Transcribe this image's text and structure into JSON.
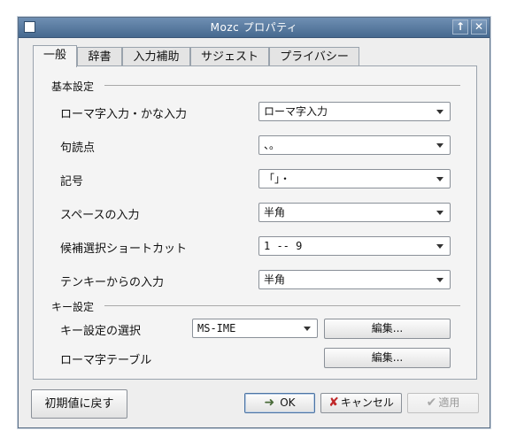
{
  "window": {
    "title": "Mozc プロパティ"
  },
  "titlebar": {
    "up_label": "↑",
    "close_label": "✕"
  },
  "tabs": [
    "一般",
    "辞書",
    "入力補助",
    "サジェスト",
    "プライバシー"
  ],
  "basic": {
    "group_title": "基本設定",
    "rows": [
      {
        "label": "ローマ字入力・かな入力",
        "value": "ローマ字入力"
      },
      {
        "label": "句読点",
        "value": "、。"
      },
      {
        "label": "記号",
        "value": "「」・"
      },
      {
        "label": "スペースの入力",
        "value": "半角"
      },
      {
        "label": "候補選択ショートカット",
        "value": "1 -- 9"
      },
      {
        "label": "テンキーからの入力",
        "value": "半角"
      }
    ]
  },
  "keys": {
    "group_title": "キー設定",
    "keymap_label": "キー設定の選択",
    "keymap_value": "MS-IME",
    "keymap_edit": "編集...",
    "romaji_label": "ローマ字テーブル",
    "romaji_edit": "編集..."
  },
  "footer": {
    "reset_label": "初期値に戻す",
    "ok_label": "OK",
    "cancel_label": "キャンセル",
    "apply_label": "適用"
  },
  "colors": {
    "titlebar": "#5a7ea5",
    "ok_icon": "#4a6b3a",
    "cancel_icon": "#c0282a"
  }
}
